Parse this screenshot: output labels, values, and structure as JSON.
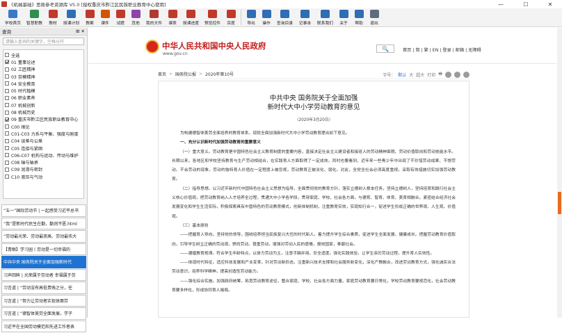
{
  "window": {
    "title": "《机械基础》思政参考资源库 V5.0 [授权重庆市黔江区民族职业教育中心使用]",
    "min": "—",
    "max": "☐",
    "close": "✕"
  },
  "toolbar": {
    "left": [
      {
        "label": "学校首页",
        "color": "#3a78c8",
        "icon": "home-icon"
      },
      {
        "label": "智慧职教",
        "color": "#2f8f4e",
        "icon": "network-icon"
      },
      {
        "label": "教材",
        "color": "#c0392b",
        "icon": "book-icon"
      },
      {
        "label": "授课计划",
        "color": "#2c6fb7",
        "icon": "calendar-icon"
      },
      {
        "label": "教案",
        "color": "#c0392b",
        "icon": "document-icon"
      },
      {
        "label": "课件",
        "color": "#d35400",
        "icon": "slides-icon"
      },
      {
        "label": "试题",
        "color": "#c0392b",
        "icon": "quiz-icon"
      },
      {
        "label": "其他",
        "color": "#8e44ad",
        "icon": "folder-icon"
      },
      {
        "label": "我的文件",
        "color": "#b03a2e",
        "icon": "my-files-icon"
      },
      {
        "label": "课表",
        "color": "#c0392b",
        "icon": "timetable-icon"
      },
      {
        "label": "授课进度",
        "color": "#c0392b",
        "icon": "progress-icon"
      },
      {
        "label": "预览控件",
        "color": "#c0392b",
        "icon": "preview-icon"
      },
      {
        "label": "百度",
        "color": "#c0392b",
        "icon": "baidu-icon"
      }
    ],
    "right": [
      {
        "label": "导出",
        "color": "#2f6db5",
        "icon": "export-icon"
      },
      {
        "label": "操作",
        "color": "#2f6db5",
        "icon": "operate-icon"
      },
      {
        "label": "查询目录",
        "color": "#2f6db5",
        "icon": "query-icon"
      },
      {
        "label": "记事本",
        "color": "#2f6db5",
        "icon": "notepad-icon"
      },
      {
        "label": "联系我们",
        "color": "#2f6db5",
        "icon": "contact-icon"
      },
      {
        "label": "关于",
        "color": "#2f6db5",
        "icon": "about-icon"
      },
      {
        "label": "帮助",
        "color": "#2f6db5",
        "icon": "help-icon"
      },
      {
        "label": "退出",
        "color": "#5d6d7e",
        "icon": "exit-icon"
      }
    ]
  },
  "leftpane": {
    "header": "查询",
    "header_ctrl": "⊞ ✕",
    "search_placeholder": "请输入查询的关键字，空格分开",
    "categories": [
      {
        "label": "全选",
        "checked": false
      },
      {
        "label": "01 董事论述",
        "checked": true
      },
      {
        "label": "02 工匠精神",
        "checked": false
      },
      {
        "label": "03 劳模精神",
        "checked": false
      },
      {
        "label": "04 安全教育",
        "checked": false
      },
      {
        "label": "05 时代楷模",
        "checked": false
      },
      {
        "label": "06 职业素养",
        "checked": false
      },
      {
        "label": "07 机械创新",
        "checked": false
      },
      {
        "label": "08 机械历史",
        "checked": false
      },
      {
        "label": "09 重庆市黔江区民族职业教育中心",
        "checked": true
      },
      {
        "label": "C00 绪论",
        "checked": false
      },
      {
        "label": "C01-C03 力系与平衡、强度与刚度",
        "checked": false
      },
      {
        "label": "C04 误差与公差",
        "checked": false
      },
      {
        "label": "C05 连接与紧固",
        "checked": false
      },
      {
        "label": "C06-C07 机构与运动、传动与维护",
        "checked": false
      },
      {
        "label": "C08 轴与轴承",
        "checked": false
      },
      {
        "label": "C09 润滑与密封",
        "checked": false
      },
      {
        "label": "C10 液压与气动",
        "checked": false
      }
    ],
    "results": [
      {
        "text": "“五一”国际劳动节 | 一起感受习近平总书",
        "selected": false
      },
      {
        "text": "“我”是新时代民生在勤，勤则不匮.html",
        "selected": false
      },
      {
        "text": "“劳动最光荣、劳动最崇高、劳动最伟大",
        "selected": false
      },
      {
        "text": "【青眼】学习园丨劳动是一切幸福的",
        "selected": false
      },
      {
        "text": "中共中央 国务院关于全面加强新时代",
        "selected": true
      },
      {
        "text": "习声回眸 | 光荣属于劳动者 幸福属于劳",
        "selected": false
      },
      {
        "text": "习言道 | “劳动没有高低贵贱之分，任",
        "selected": false
      },
      {
        "text": "习言道 | “努力让劳动者实现体面劳",
        "selected": false
      },
      {
        "text": "习言道 | “德智体美劳全面发展，学子",
        "selected": false
      },
      {
        "text": "习近平在全国劳动模范和先进工作者表",
        "selected": false
      }
    ]
  },
  "gov": {
    "title": "中华人民共和国中央人民政府",
    "url": "www.gov.cn",
    "search_icon": "🔍",
    "links": "首页 | 简 | 繁 | EN | 登录 | 邮箱 | 无障碍"
  },
  "crumb": {
    "a": "首页",
    "b": "国务院公报",
    "c": "2020年第10号",
    "sep": ">",
    "fontsize": "字号：",
    "fsize_default": "默认",
    "fsize_big": "大",
    "fsize_bigger": "超大",
    "print": "打印",
    "print_icon": "🖶"
  },
  "article": {
    "title1": "中共中央 国务院关于全面加强",
    "title2": "新时代大中小学劳动教育的意见",
    "date": "（2020年3月20日）",
    "paras": [
      {
        "t": "为构建德智体美劳全面培养的教育体系，现就全面加强新时代大中小学劳动教育提出如下意见。",
        "b": false
      },
      {
        "t": "一、充分认识新时代加强劳动教育的重要意义",
        "b": true
      },
      {
        "t": "（一）重大意义。劳动教育是中国特色社会主义教育制度的重要内容，直接决定社会主义建设者和接班人的劳动精神面貌、劳动价值取向和劳动技能水平。长期以来，各地区和学校坚持教育与生产劳动相结合，在实践育人方面取得了一定成效。同时也要看到，近年来一些青少年中出现了不珍惜劳动成果、不想劳动、不会劳动的现象，劳动的独特育人价值在一定程度上被忽视，劳动教育正被淡化、弱化。对此，全党全社会必须高度重视，采取有效措施切实加强劳动教育。",
        "b": false
      },
      {
        "t": "（二）指导思想。以习近平新时代中国特色社会主义思想为指导，全面贯彻党的教育方针，落实立德树人根本任务，坚持立德树人，坚持培育和践行社会主义核心价值观，把劳动教育纳入人才培养全过程，贯通大中小学各学段，贯穿家庭、学校、社会各方面，与德育、智育、体育、美育相融合，紧密结合经济社会发展变化和学生生活实际，积极探索具有中国特色的劳动教育模式，创新体制机制，注重教育实效，实现知行合一，促进学生形成正确的世界观、人生观、价值观。",
        "b": false
      },
      {
        "t": "（三）基本原则",
        "b": false
      },
      {
        "t": "——把握育人导向。坚持党的领导，围绕培养担当民族复兴大任的时代新人，着力提升学生综合素质，促进学生全面发展、健康成长。把握劳动教育价值取向，引导学生树立正确的劳动观，崇尚劳动、尊重劳动，增强对劳动人民的感情，报效国家，奉献社会。",
        "b": false
      },
      {
        "t": "——遵循教育规律。符合学生年龄特点，以体力劳动为主，注意手脑并用、安全适度，强化实践体验，让学生亲历劳动过程，提升育人实效性。",
        "b": false
      },
      {
        "t": "——体现时代特征。适应科技发展和产业变革，针对劳动新形态，注重新兴技术支撑和社会服务新变化，深化产教融合，改进劳动教育方式，强化诚实合法劳动意识，培养科学精神，提高创造性劳动能力。",
        "b": false
      },
      {
        "t": "——强化综合实施。加强政府统筹，拓宽劳动教育途径，整合家庭、学校、社会各方面力量。家庭劳动教育要日常化，学校劳动教育要规范化，社会劳动教育要多样化，形成协同育人格局。",
        "b": false
      }
    ]
  }
}
